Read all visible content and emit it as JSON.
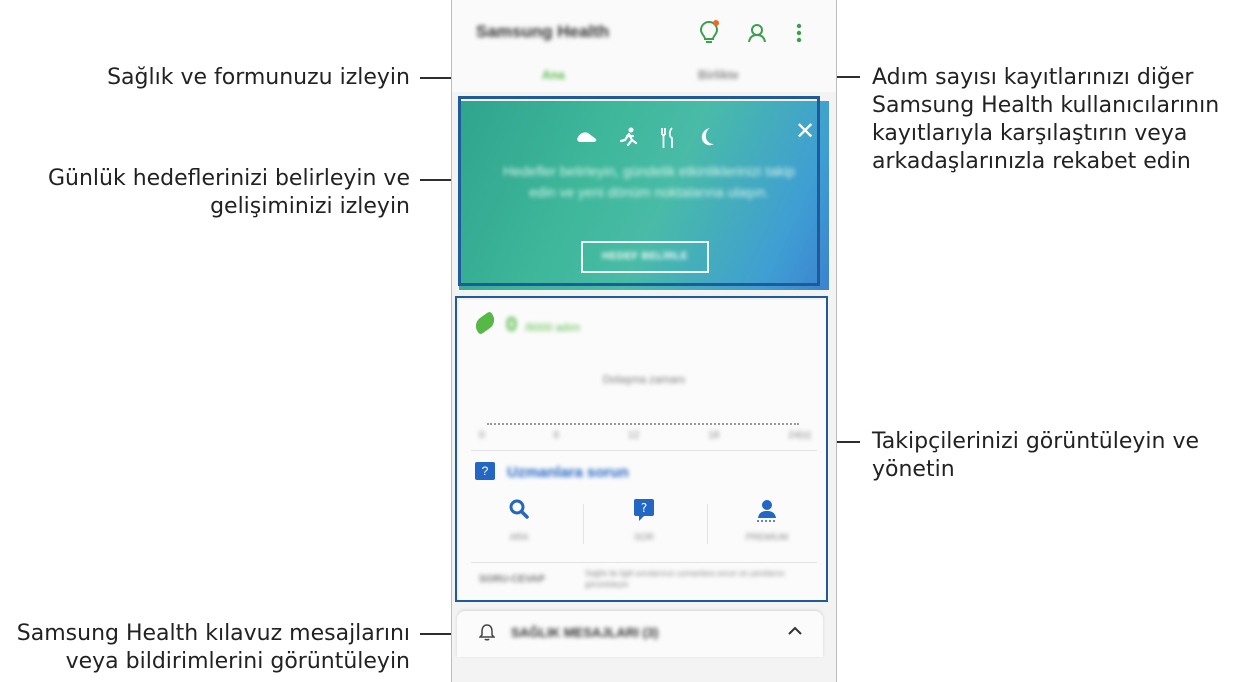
{
  "callouts": {
    "health": "Sağlık ve formunuzu izleyin",
    "goals_line1": "Günlük hedeflerinizi belirleyin ve",
    "goals_line2": "gelişiminizi izleyin",
    "messages_line1": "Samsung Health kılavuz mesajlarını",
    "messages_line2": "veya bildirimlerini görüntüleyin",
    "steps_line1": "Adım sayısı kayıtlarınızı diğer",
    "steps_line2": "Samsung Health kullanıcılarının",
    "steps_line3": "kayıtlarıyla karşılaştırın veya",
    "steps_line4": "arkadaşlarınızla rekabet edin",
    "followers_line1": "Takipçilerinizi görüntüleyin ve",
    "followers_line2": "yönetin"
  },
  "app": {
    "title": "Samsung Health",
    "tabs": [
      "Ana",
      "Birlikte"
    ],
    "accent": "#3aa04b"
  },
  "goals_card": {
    "text": "Hedefler belirleyin, gündelik etkinliklerinizi takip edin ve yeni dönüm noktalarına ulaşın.",
    "button": "HEDEF BELİRLE"
  },
  "steps_card": {
    "count": "0",
    "unit": "/6000 adım",
    "walk_label": "Dolaşma zamanı",
    "axis": [
      "0",
      "6",
      "12",
      "18",
      "24(s)"
    ]
  },
  "ask_experts": {
    "title": "Uzmanlara sorun",
    "actions": [
      "ARA",
      "SOR",
      "PREMİUM"
    ],
    "qa_label": "SORU-CEVAP",
    "qa_text": "Sağlık ile ilgili sorularınızı uzmanlara sorun ve yanıtlarını görüntüleyin"
  },
  "messages": {
    "title": "SAĞLIK MESAJLARI (3)"
  }
}
